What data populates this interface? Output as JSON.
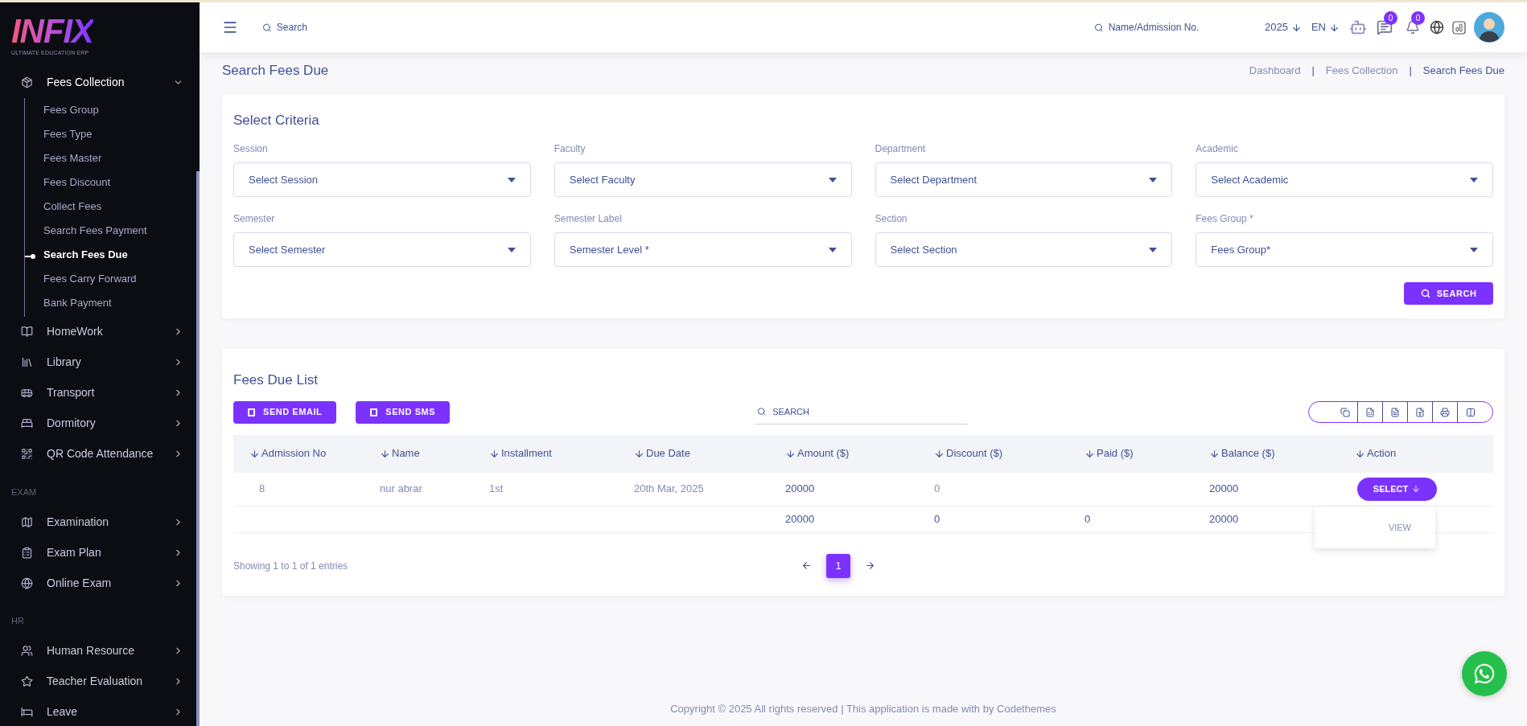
{
  "sidebar": {
    "logo": {
      "title": "INFIX",
      "subtitle": "ULTIMATE EDUCATION ERP"
    },
    "sections": [
      {
        "items": [
          {
            "label": "Fees Collection",
            "expanded": true,
            "children": [
              {
                "label": "Fees Group",
                "selected": false
              },
              {
                "label": "Fees Type",
                "selected": false
              },
              {
                "label": "Fees Master",
                "selected": false
              },
              {
                "label": "Fees Discount",
                "selected": false
              },
              {
                "label": "Collect Fees",
                "selected": false
              },
              {
                "label": "Search Fees Payment",
                "selected": false
              },
              {
                "label": "Search Fees Due",
                "selected": true
              },
              {
                "label": "Fees Carry Forward",
                "selected": false
              },
              {
                "label": "Bank Payment",
                "selected": false
              }
            ]
          },
          {
            "label": "HomeWork",
            "expanded": false
          },
          {
            "label": "Library",
            "expanded": false
          },
          {
            "label": "Transport",
            "expanded": false
          },
          {
            "label": "Dormitory",
            "expanded": false
          },
          {
            "label": "QR Code Attendance",
            "expanded": false
          }
        ]
      },
      {
        "heading": "EXAM",
        "items": [
          {
            "label": "Examination",
            "expanded": false
          },
          {
            "label": "Exam Plan",
            "expanded": false
          },
          {
            "label": "Online Exam",
            "expanded": false
          }
        ]
      },
      {
        "heading": "HR",
        "items": [
          {
            "label": "Human Resource",
            "expanded": false
          },
          {
            "label": "Teacher Evaluation",
            "expanded": false
          },
          {
            "label": "Leave",
            "expanded": false
          }
        ]
      }
    ]
  },
  "header": {
    "search_placeholder": "Search",
    "student_search_placeholder": "Name/Admission No.",
    "year": "2025",
    "language": "EN",
    "messages_badge": "0",
    "notifications_badge": "0"
  },
  "page_title": "Search Fees Due",
  "breadcrumb_separator": "|",
  "breadcrumb": [
    {
      "label": "Dashboard",
      "current": false
    },
    {
      "label": "Fees Collection",
      "current": false
    },
    {
      "label": "Search Fees Due",
      "current": true
    }
  ],
  "criteria": {
    "title": "Select Criteria",
    "fields": [
      {
        "label": "Session",
        "placeholder": "Select Session"
      },
      {
        "label": "Faculty",
        "placeholder": "Select Faculty"
      },
      {
        "label": "Department",
        "placeholder": "Select Department"
      },
      {
        "label": "Academic",
        "placeholder": "Select Academic"
      },
      {
        "label": "Semester",
        "placeholder": "Select Semester"
      },
      {
        "label": "Semester Label",
        "placeholder": "Semester Level *"
      },
      {
        "label": "Section",
        "placeholder": "Select Section"
      },
      {
        "label": "Fees Group *",
        "placeholder": "Fees Group*"
      }
    ],
    "button": "SEARCH"
  },
  "due_list": {
    "title": "Fees Due List",
    "buttons": [
      "SEND EMAIL",
      "SEND SMS"
    ],
    "search_placeholder": "SEARCH",
    "columns": [
      "Admission No",
      "Name",
      "Installment",
      "Due Date",
      "Amount ($)",
      "Discount ($)",
      "Paid ($)",
      "Balance ($)",
      "Action"
    ],
    "rows": [
      {
        "admission_no": "8",
        "name": "nur abrar",
        "installment": "1st",
        "due_date": "20th Mar, 2025",
        "amount": "20000",
        "discount": "0",
        "balance": "20000",
        "action": {
          "label": "SELECT",
          "menu_open": true,
          "menu": [
            "VIEW"
          ]
        }
      }
    ],
    "totals": {
      "amount": "20000",
      "discount": "0",
      "paid": "0",
      "balance": "20000"
    },
    "info": "Showing 1 to 1 of 1 entries",
    "pages": [
      {
        "label": "1",
        "selected": true
      }
    ]
  },
  "footer": "Copyright © 2025 All rights reserved | This application is made with by Codethemes"
}
